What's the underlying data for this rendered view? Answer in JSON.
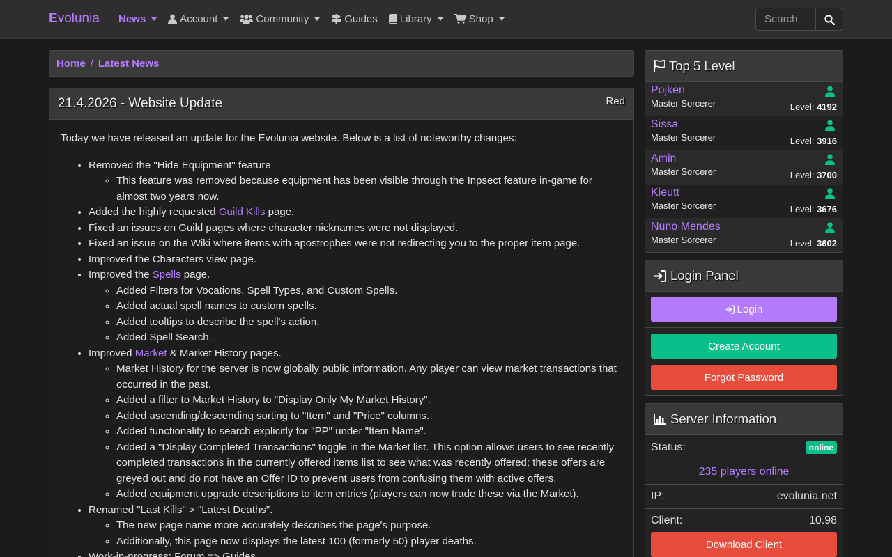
{
  "brand": {
    "first": "E",
    "rest": "volunia"
  },
  "nav": [
    {
      "label": "News",
      "icon": "none",
      "dropdown": true,
      "active": true
    },
    {
      "label": "Account",
      "icon": "user-icon",
      "dropdown": true
    },
    {
      "label": "Community",
      "icon": "users-icon",
      "dropdown": true
    },
    {
      "label": "Guides",
      "icon": "signpost-icon",
      "dropdown": false
    },
    {
      "label": "Library",
      "icon": "book-icon",
      "dropdown": true
    },
    {
      "label": "Shop",
      "icon": "cart-icon",
      "dropdown": true
    }
  ],
  "search": {
    "placeholder": "Search",
    "icon": "search-icon"
  },
  "breadcrumb": {
    "home": "Home",
    "sep": "/",
    "current": "Latest News"
  },
  "article": {
    "title": "21.4.2026 - Website Update",
    "author": "Red",
    "intro": "Today we have released an update for the Evolunia website. Below is a list of noteworthy changes:",
    "items": [
      {
        "text": "Removed the \"Hide Equipment\" feature",
        "sub": [
          "This feature was removed because equipment has been visible through the Inpsect feature in-game for almost two years now."
        ]
      },
      {
        "before": "Added the highly requested ",
        "link": "Guild Kills",
        "after": " page."
      },
      {
        "text": "Fixed an issues on Guild pages where character nicknames were not displayed."
      },
      {
        "text": "Fixed an issue on the Wiki where items with apostrophes were not redirecting you to the proper item page."
      },
      {
        "text": "Improved the Characters view page."
      },
      {
        "before": "Improved the ",
        "link": "Spells",
        "after": " page.",
        "sub": [
          "Added Filters for Vocations, Spell Types, and Custom Spells.",
          "Added actual spell names to custom spells.",
          "Added tooltips to describe the spell's action.",
          "Added Spell Search."
        ]
      },
      {
        "before": "Improved ",
        "link": "Market",
        "after": " & Market History pages.",
        "sub": [
          "Market History for the server is now globally public information. Any player can view market transactions that occurred in the past.",
          "Added a filter to Market History to \"Display Only My Market History\".",
          "Added ascending/descending sorting to \"Item\" and \"Price\" columns.",
          "Added functionality to search explicitly for \"PP\" under \"Item Name\".",
          "Added a \"Display Completed Transactions\" toggle in the Market list. This option allows users to see recently completed transactions in the currently offered items list to see what was recently offered; these offers are greyed out and do not have an Offer ID to prevent users from confusing them with active offers.",
          "Added equipment upgrade descriptions to item entries (players can now trade these via the Market)."
        ]
      },
      {
        "text": "Renamed \"Last Kills\" > \"Latest Deaths\".",
        "sub": [
          "The new page name more accurately describes the page's purpose.",
          "Additionally, this page now displays the latest 100 (formerly 50) player deaths."
        ]
      },
      {
        "text": "Work-in-progress: Forum => Guides"
      }
    ]
  },
  "top5": {
    "title": "Top 5 Level",
    "icon": "flag-icon",
    "level_prefix": "Level:",
    "players": [
      {
        "name": "Pojken",
        "vocation": "Master Sorcerer",
        "level": "4192"
      },
      {
        "name": "Sissa",
        "vocation": "Master Sorcerer",
        "level": "3916"
      },
      {
        "name": "Amin",
        "vocation": "Master Sorcerer",
        "level": "3700"
      },
      {
        "name": "Kieutt",
        "vocation": "Master Sorcerer",
        "level": "3676"
      },
      {
        "name": "Nuno Mendes",
        "vocation": "Master Sorcerer",
        "level": "3602"
      }
    ]
  },
  "login": {
    "title": "Login Panel",
    "icon": "sign-in-icon",
    "login_label": "Login",
    "create_label": "Create Account",
    "forgot_label": "Forgot Password"
  },
  "server": {
    "title": "Server Information",
    "icon": "chart-icon",
    "status_label": "Status:",
    "status_value": "online",
    "players_online": "235 players online",
    "ip_label": "IP:",
    "ip_value": "evolunia.net",
    "client_label": "Client:",
    "client_value": "10.98",
    "download_label": "Download Client"
  },
  "colors": {
    "accent": "#b57bff",
    "green": "#0bbf8b",
    "red": "#e74c3c",
    "background": "#1b1b1b"
  }
}
